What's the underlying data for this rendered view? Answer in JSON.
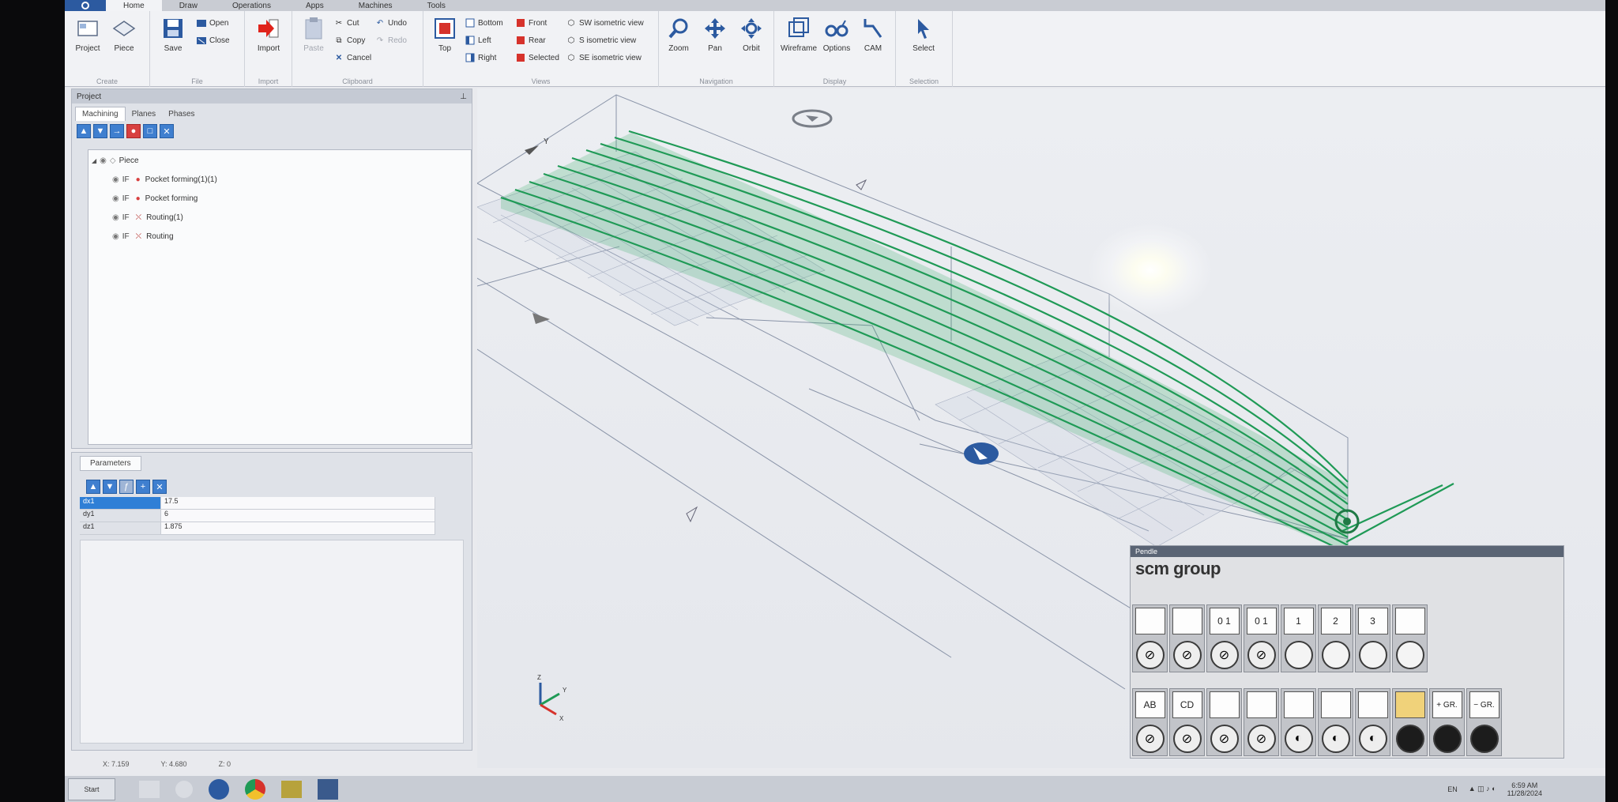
{
  "ribbon": {
    "tabs": [
      "Home",
      "Draw",
      "Operations",
      "Apps",
      "Machines",
      "Tools"
    ],
    "groups": {
      "create": {
        "label": "Create",
        "project": "Project",
        "piece": "Piece"
      },
      "file": {
        "label": "File",
        "save": "Save",
        "open": "Open",
        "close": "Close"
      },
      "import": {
        "label": "Import",
        "import": "Import"
      },
      "clipboard": {
        "label": "Clipboard",
        "paste": "Paste",
        "cut": "Cut",
        "copy": "Copy",
        "cancel": "Cancel",
        "undo": "Undo",
        "redo": "Redo"
      },
      "views": {
        "label": "Views",
        "top": "Top",
        "bottom": "Bottom",
        "left": "Left",
        "right": "Right",
        "front": "Front",
        "rear": "Rear",
        "selected": "Selected",
        "sw": "SW isometric view",
        "s": "S isometric view",
        "se": "SE isometric view"
      },
      "navigation": {
        "label": "Navigation",
        "zoom": "Zoom",
        "pan": "Pan",
        "orbit": "Orbit"
      },
      "display": {
        "label": "Display",
        "wireframe": "Wireframe",
        "options": "Options",
        "cam": "CAM"
      },
      "selection": {
        "label": "Selection",
        "select": "Select"
      }
    }
  },
  "project": {
    "title": "Project",
    "subtabs": [
      "Machining",
      "Planes",
      "Phases"
    ],
    "tree": [
      {
        "label": "Piece"
      },
      {
        "tag": "IF",
        "label": "Pocket forming(1)(1)"
      },
      {
        "tag": "IF",
        "label": "Pocket forming"
      },
      {
        "tag": "IF",
        "label": "Routing(1)"
      },
      {
        "tag": "IF",
        "label": "Routing"
      }
    ]
  },
  "parameters": {
    "title": "Parameters",
    "rows": [
      {
        "name": "dx1",
        "value": "17.5"
      },
      {
        "name": "dy1",
        "value": "6"
      },
      {
        "name": "dz1",
        "value": "1.875"
      }
    ]
  },
  "status": {
    "x": "X: 7.159",
    "y": "Y: 4.680",
    "z": "Z: 0"
  },
  "taskbar": {
    "start": "Start",
    "lang": "EN",
    "time": "6:59 AM",
    "date": "11/28/2024"
  },
  "viewport": {
    "axis_y": "Y",
    "axis_x": "X",
    "triad": [
      "Z",
      "Y",
      "X"
    ]
  },
  "pendant": {
    "title": "Pendle",
    "brand": "scm group",
    "row1": [
      "",
      "",
      "0 1",
      "0 1",
      "1",
      "2",
      "3",
      ""
    ],
    "row2": [
      "AB",
      "CD",
      "",
      "",
      "",
      "",
      "",
      "",
      "+ GR.",
      "− GR."
    ]
  },
  "colors": {
    "accent": "#2c5aa0",
    "toolpath": "#1f9a56",
    "wire": "#8a94a8"
  }
}
